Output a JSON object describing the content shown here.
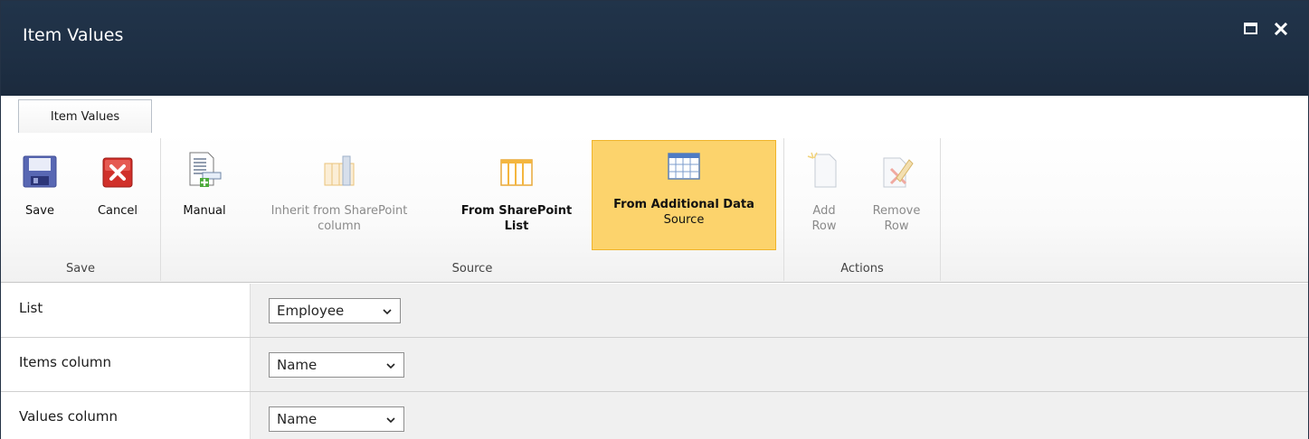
{
  "window": {
    "title": "Item Values"
  },
  "tab": {
    "label": "Item Values"
  },
  "ribbon": {
    "groups": {
      "save": {
        "label": "Save",
        "buttons": {
          "save": "Save",
          "cancel": "Cancel"
        }
      },
      "source": {
        "label": "Source",
        "buttons": {
          "manual": "Manual",
          "inherit_line1": "Inherit from SharePoint",
          "inherit_line2": "column",
          "fromlist_line1": "From SharePoint",
          "fromlist_line2": "List",
          "additional_line1": "From Additional Data",
          "additional_line2": "Source"
        }
      },
      "actions": {
        "label": "Actions",
        "buttons": {
          "addrow_line1": "Add",
          "addrow_line2": "Row",
          "removerow_line1": "Remove",
          "removerow_line2": "Row"
        }
      }
    }
  },
  "form": {
    "rows": [
      {
        "label": "List",
        "value": "Employee"
      },
      {
        "label": "Items column",
        "value": "Name"
      },
      {
        "label": "Values column",
        "value": "Name"
      }
    ]
  },
  "colors": {
    "title_bar": "#1e2f44",
    "selected_button": "#fcd36c",
    "form_bg": "#f0f0f0"
  }
}
